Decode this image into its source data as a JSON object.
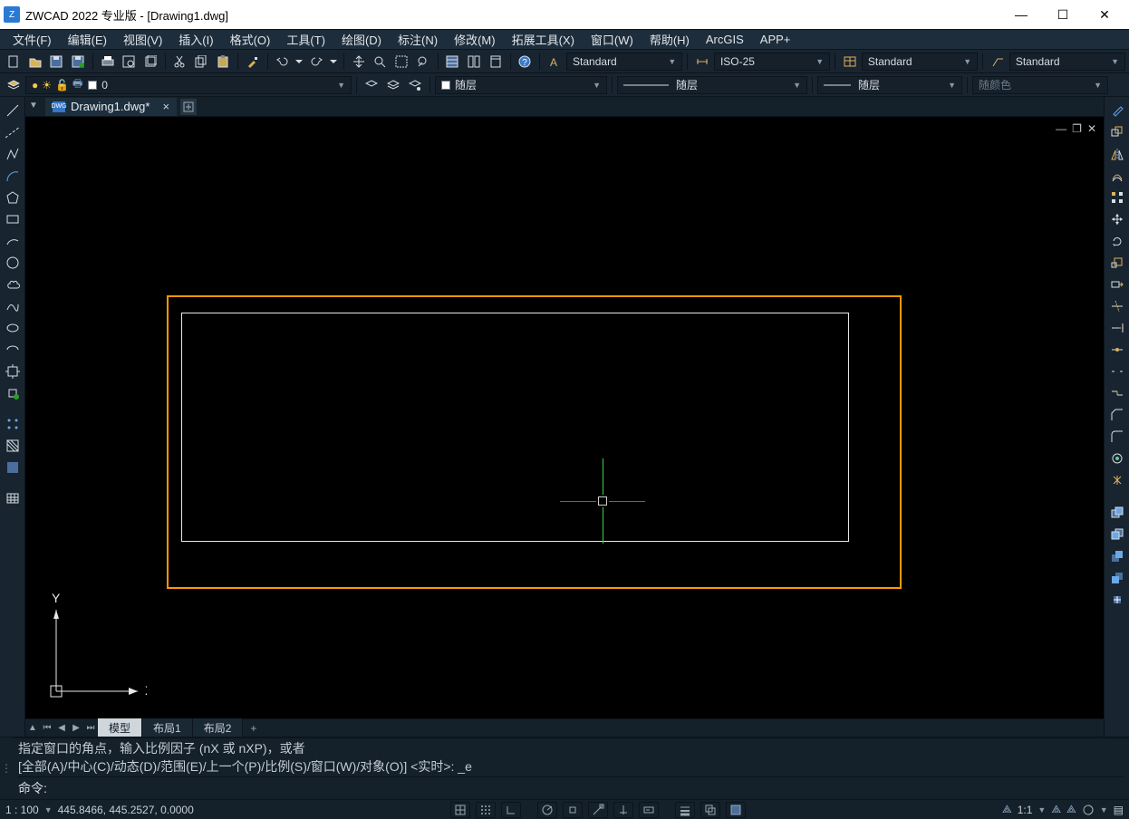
{
  "title": "ZWCAD 2022 专业版 - [Drawing1.dwg]",
  "menu": {
    "file": "文件(F)",
    "edit": "编辑(E)",
    "view": "视图(V)",
    "insert": "插入(I)",
    "format": "格式(O)",
    "tools": "工具(T)",
    "draw": "绘图(D)",
    "dimension": "标注(N)",
    "modify": "修改(M)",
    "extend_tools": "拓展工具(X)",
    "window": "窗口(W)",
    "help": "帮助(H)",
    "arcgis": "ArcGIS",
    "appplus": "APP+"
  },
  "styles": {
    "text_style": "Standard",
    "dim_style": "ISO-25",
    "table_style": "Standard",
    "mleader_style": "Standard"
  },
  "layer": {
    "current": "0",
    "color_by": "随层",
    "linetype_by": "随层",
    "lineweight_by": "随层",
    "plotstyle_by": "随颜色"
  },
  "doc_tab": {
    "name": "Drawing1.dwg*"
  },
  "layout_tabs": {
    "model": "模型",
    "layout1": "布局1",
    "layout2": "布局2",
    "add": "+"
  },
  "command": {
    "history_line1": "指定窗口的角点，输入比例因子 (nX 或 nXP)，或者",
    "history_line2": "[全部(A)/中心(C)/动态(D)/范围(E)/上一个(P)/比例(S)/窗口(W)/对象(O)] <实时>: _e",
    "prompt": "命令:",
    "input": ""
  },
  "status": {
    "scale_label": "1 : 100",
    "coords": "445.8466, 445.2527, 0.0000",
    "anno_scale": "1:1"
  },
  "icons": {
    "new": "new",
    "open": "open",
    "save": "save",
    "saveas": "saveas",
    "print": "print",
    "preview": "preview",
    "cut": "cut",
    "copy": "copy",
    "paste": "paste",
    "match": "match",
    "undo": "undo",
    "redo": "redo",
    "pan": "pan",
    "zoom": "zoom",
    "zoomwin": "zoomwin",
    "props": "props",
    "grid": "grid",
    "calc": "calc",
    "help": "help"
  }
}
